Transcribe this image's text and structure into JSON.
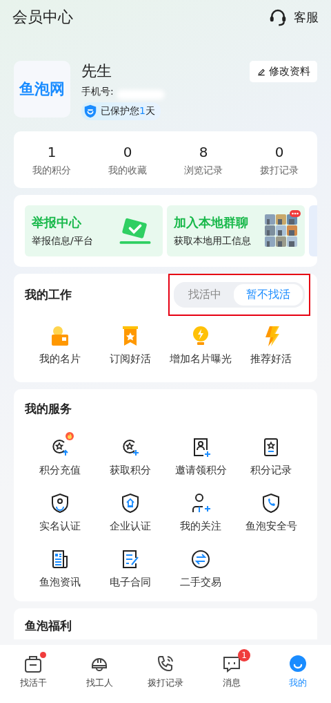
{
  "header": {
    "title": "会员中心",
    "service_label": "客服"
  },
  "profile": {
    "logo_text": "鱼泡网",
    "name": "先生",
    "phone_label": "手机号:",
    "protect": {
      "prefix": "已保护您",
      "days": "1",
      "suffix": "天"
    },
    "edit_button": "修改资料"
  },
  "stats": [
    {
      "value": "1",
      "label": "我的积分"
    },
    {
      "value": "0",
      "label": "我的收藏"
    },
    {
      "value": "8",
      "label": "浏览记录"
    },
    {
      "value": "0",
      "label": "拨打记录"
    }
  ],
  "banners": [
    {
      "kind": "report",
      "title": "举报中心",
      "subtitle": "举报信息/平台"
    },
    {
      "kind": "group",
      "title": "加入本地群聊",
      "subtitle": "获取本地用工信息"
    }
  ],
  "work": {
    "title": "我的工作",
    "toggle": [
      {
        "label": "找活中",
        "selected": false
      },
      {
        "label": "暂不找活",
        "selected": true
      }
    ],
    "toggle_highlighted": true,
    "items": [
      {
        "label": "我的名片"
      },
      {
        "label": "订阅好活"
      },
      {
        "label": "增加名片曝光"
      },
      {
        "label": "推荐好活"
      }
    ]
  },
  "services": {
    "title": "我的服务",
    "items": [
      {
        "label": "积分充值",
        "hot": true
      },
      {
        "label": "获取积分",
        "hot": false
      },
      {
        "label": "邀请领积分",
        "hot": false
      },
      {
        "label": "积分记录",
        "hot": false
      },
      {
        "label": "实名认证",
        "hot": false
      },
      {
        "label": "企业认证",
        "hot": false
      },
      {
        "label": "我的关注",
        "hot": false
      },
      {
        "label": "鱼泡安全号",
        "hot": false
      },
      {
        "label": "鱼泡资讯",
        "hot": false
      },
      {
        "label": "电子合同",
        "hot": false
      },
      {
        "label": "二手交易",
        "hot": false
      }
    ]
  },
  "welfare": {
    "title": "鱼泡福利"
  },
  "tab_bar": [
    {
      "label": "找活干",
      "selected": false,
      "dot": true
    },
    {
      "label": "找工人",
      "selected": false,
      "dot": false
    },
    {
      "label": "拨打记录",
      "selected": false,
      "dot": false
    },
    {
      "label": "消息",
      "selected": false,
      "dot": false,
      "badge": "1"
    },
    {
      "label": "我的",
      "selected": true,
      "dot": false
    }
  ]
}
